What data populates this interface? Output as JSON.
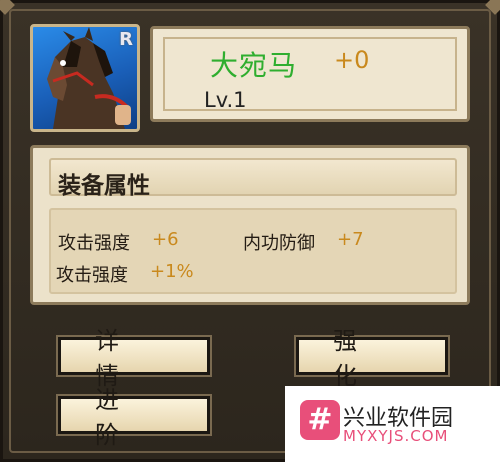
{
  "item": {
    "rarity": "R",
    "name": "大宛马",
    "enhance": "+0",
    "level": "Lv.1"
  },
  "attributes": {
    "title": "装备属性",
    "stats": [
      {
        "label": "攻击强度",
        "value": "+6"
      },
      {
        "label": "内功防御",
        "value": "+7"
      },
      {
        "label": "攻击强度",
        "value": "+1%"
      }
    ]
  },
  "buttons": {
    "details": "详情",
    "enhance": "强化",
    "advance": "进阶"
  },
  "watermark": {
    "glyph": "#",
    "title": "兴业软件园",
    "url": "MYXYJS.COM"
  },
  "colors": {
    "name_green": "#2fae2f",
    "value_gold": "#c9891d",
    "panel_bg": "#ece2ca",
    "frame_bg": "#2c261d"
  },
  "icons": {
    "portrait": "horse-portrait-icon"
  }
}
